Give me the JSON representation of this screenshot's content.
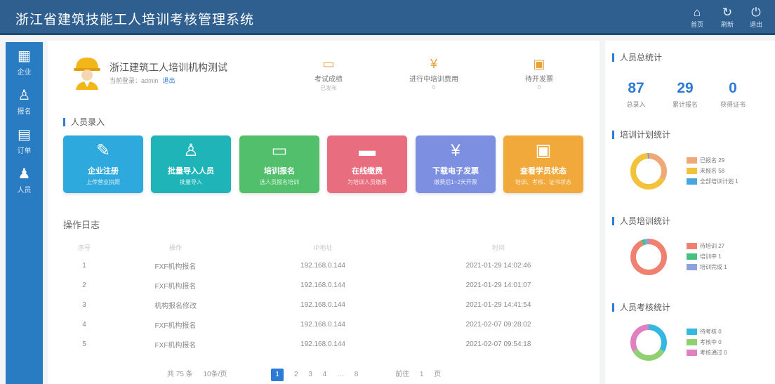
{
  "header": {
    "title": "浙江省建筑技能工人培训考核管理系统",
    "buttons": [
      {
        "icon": "home-icon",
        "label": "首页"
      },
      {
        "icon": "refresh-icon",
        "label": "刷新"
      },
      {
        "icon": "power-icon",
        "label": "退出"
      }
    ]
  },
  "sidebar": {
    "items": [
      {
        "icon": "building-icon",
        "label": "企业"
      },
      {
        "icon": "user-icon",
        "label": "报名"
      },
      {
        "icon": "order-icon",
        "label": "订单"
      },
      {
        "icon": "group-icon",
        "label": "人员"
      }
    ]
  },
  "org": {
    "name": "浙江建筑工人培训机构测试",
    "sub": "当前登录：admin",
    "logout": "退出"
  },
  "quick": [
    {
      "icon": "id-card-icon",
      "label": "考试成绩",
      "sub": "已发布"
    },
    {
      "icon": "money-icon",
      "label": "进行中培训费用",
      "sub": "0"
    },
    {
      "icon": "document-icon",
      "label": "待开发票",
      "sub": "0"
    }
  ],
  "entry": {
    "title": "人员录入",
    "cards": [
      {
        "icon": "edit-icon",
        "label": "企业注册",
        "sub": "上传营业执照",
        "color": "#2ea9dd"
      },
      {
        "icon": "person-add-icon",
        "label": "批量导入人员",
        "sub": "批量导入",
        "color": "#1fb4b8"
      },
      {
        "icon": "monitor-icon",
        "label": "培训报名",
        "sub": "选人员报名培训",
        "color": "#52bf6c"
      },
      {
        "icon": "card-icon",
        "label": "在线缴费",
        "sub": "为培训人员缴费",
        "color": "#e86d7e"
      },
      {
        "icon": "invoice-icon",
        "label": "下载电子发票",
        "sub": "缴费后1~2天开票",
        "color": "#7c8fe0"
      },
      {
        "icon": "status-icon",
        "label": "查看学员状态",
        "sub": "培训、考核、证书状态",
        "color": "#f0a93a"
      }
    ]
  },
  "log": {
    "title": "操作日志",
    "headers": [
      "序号",
      "操作",
      "IP地址",
      "时间"
    ],
    "rows": [
      {
        "no": "1",
        "op": "FXF机构报名",
        "ip": "192.168.0.144",
        "time": "2021-01-29 14:02:46"
      },
      {
        "no": "2",
        "op": "FXF机构报名",
        "ip": "192.168.0.144",
        "time": "2021-01-29 14:01:07"
      },
      {
        "no": "3",
        "op": "机构报名修改",
        "ip": "192.168.0.144",
        "time": "2021-01-29 14:41:54"
      },
      {
        "no": "4",
        "op": "FXF机构报名",
        "ip": "192.168.0.144",
        "time": "2021-02-07 09:28:02"
      },
      {
        "no": "5",
        "op": "FXF机构报名",
        "ip": "192.168.0.144",
        "time": "2021-02-07 09:54:18"
      }
    ],
    "pager": {
      "total": "共 75 条",
      "per": "10条/页",
      "pages": [
        "1",
        "2",
        "3",
        "4",
        "…",
        "8"
      ],
      "goto": "前往",
      "goto_val": "1",
      "page_unit": "页"
    }
  },
  "stats": {
    "title": "人员总统计",
    "items": [
      {
        "value": "87",
        "label": "总录入"
      },
      {
        "value": "29",
        "label": "累计报名"
      },
      {
        "value": "0",
        "label": "获得证书"
      }
    ]
  },
  "plan": {
    "title": "培训计划统计",
    "legend": [
      {
        "label": "已报名 29",
        "color": "#f0a878",
        "value": 29
      },
      {
        "label": "未报名 58",
        "color": "#f2c23a",
        "value": 58
      },
      {
        "label": "全部培训计划 1",
        "color": "#4aa6e0",
        "value": 1
      }
    ]
  },
  "training": {
    "title": "人员培训统计",
    "legend": [
      {
        "label": "待培训 27",
        "color": "#f08070",
        "value": 27
      },
      {
        "label": "培训中 1",
        "color": "#45c080",
        "value": 1
      },
      {
        "label": "培训完成 1",
        "color": "#8da0e0",
        "value": 1
      }
    ]
  },
  "exam": {
    "title": "人员考核统计",
    "legend": [
      {
        "label": "待考核 0",
        "color": "#35b8e0",
        "value": 1
      },
      {
        "label": "考核中 0",
        "color": "#8fd070",
        "value": 1
      },
      {
        "label": "考核通过 0",
        "color": "#e080c0",
        "value": 1
      }
    ]
  }
}
